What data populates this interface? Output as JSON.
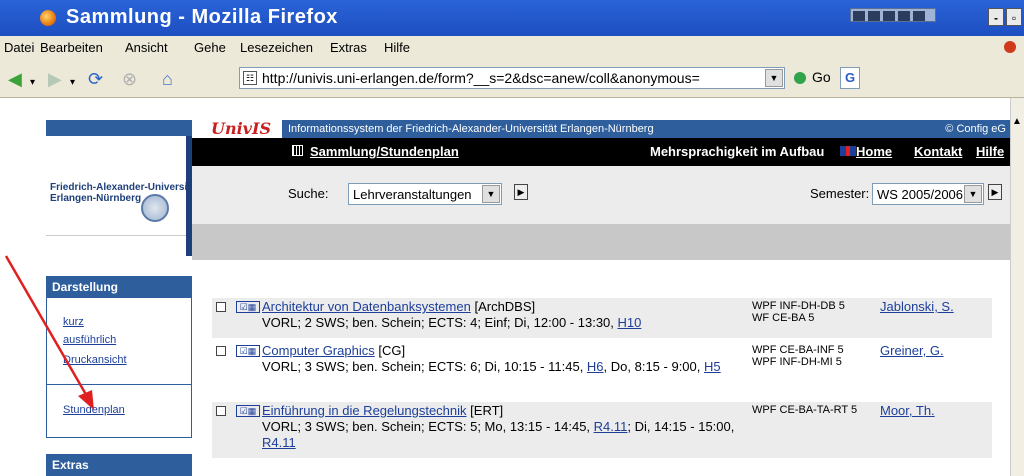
{
  "window": {
    "title": "Sammlung - Mozilla Firefox"
  },
  "menu": [
    "Datei",
    "Bearbeiten",
    "Ansicht",
    "Gehe",
    "Lesezeichen",
    "Extras",
    "Hilfe"
  ],
  "toolbar": {
    "url": "http://univis.uni-erlangen.de/form?__s=2&dsc=anew/coll&anonymous=",
    "go_label": "Go"
  },
  "univis": {
    "logo": "UnivIS",
    "header_text": "Informationssystem der Friedrich-Alexander-Universität Erlangen-Nürnberg",
    "copyright": "© Config eG",
    "university_line1": "Friedrich-Alexander-Universität",
    "university_line2": "Erlangen-Nürnberg",
    "nav": {
      "collection": "Sammlung/Stundenplan",
      "multilang": "Mehrsprachigkeit im Aufbau",
      "home": "Home",
      "kontakt": "Kontakt",
      "hilfe": "Hilfe"
    },
    "search_label": "Suche:",
    "search_value": "Lehrveranstaltungen",
    "semester_label": "Semester:",
    "semester_value": "WS 2005/2006"
  },
  "sidebar": {
    "darstellung_title": "Darstellung",
    "links": [
      "kurz",
      "ausführlich",
      "Druckansicht"
    ],
    "stundenplan": "Stundenplan",
    "extras_title": "Extras"
  },
  "courses": [
    {
      "title": "Architektur von Datenbanksystemen",
      "abbr": "[ArchDBS]",
      "detail": "VORL; 2 SWS; ben. Schein; ECTS: 4; Einf; Di, 12:00 - 13:30, ",
      "rooms": [
        "H10"
      ],
      "modules": [
        "WPF INF-DH-DB 5",
        "WF CE-BA 5"
      ],
      "lecturer": "Jablonski, S."
    },
    {
      "title": "Computer Graphics",
      "abbr": "[CG]",
      "detail_a": "VORL; 3 SWS; ben. Schein; ECTS: 6; Di, 10:15 - 11:45, ",
      "detail_b": ", Do, 8:15 - 9:00, ",
      "rooms": [
        "H6",
        "H5"
      ],
      "modules": [
        "WPF CE-BA-INF 5",
        "WPF INF-DH-MI 5"
      ],
      "lecturer": "Greiner, G."
    },
    {
      "title": "Einführung in die Regelungstechnik",
      "abbr": "[ERT]",
      "detail_a": "VORL; 3 SWS; ben. Schein; ECTS: 5; Mo, 13:15 - 14:45, ",
      "detail_b": "; Di, 14:15 - 15:00, ",
      "rooms": [
        "R4.11",
        "R4.11"
      ],
      "modules": [
        "WPF CE-BA-TA-RT 5"
      ],
      "lecturer": "Moor, Th."
    }
  ],
  "colors": {
    "univis_blue": "#2e5e9c",
    "link": "#1d3f9a",
    "arrow": "#e02020",
    "logo_red": "#c8201e"
  }
}
